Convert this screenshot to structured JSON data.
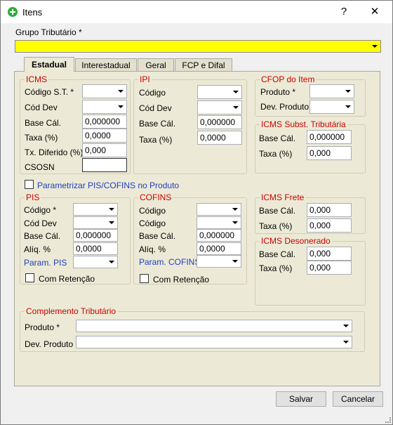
{
  "window": {
    "title": "Itens",
    "help": "?",
    "close": "✕"
  },
  "grupo": {
    "label": "Grupo Tributário *",
    "value": ""
  },
  "tabs": [
    "Estadual",
    "Interestadual",
    "Geral",
    "FCP e Difal"
  ],
  "icms": {
    "title": "ICMS",
    "codigo_st": "Código S.T. *",
    "cod_dev": "Cód Dev",
    "base_cal": "Base Cál.",
    "base_cal_value": "0,000000",
    "taxa": "Taxa (%)",
    "taxa_value": "0,0000",
    "tx_diferido": "Tx. Diferido (%)",
    "tx_diferido_value": "0,000",
    "csosn": "CSOSN",
    "csosn_value": ""
  },
  "ipi": {
    "title": "IPI",
    "codigo": "Código",
    "cod_dev": "Cód Dev",
    "base_cal": "Base Cál.",
    "base_cal_value": "0,000000",
    "taxa": "Taxa (%)",
    "taxa_value": "0,0000"
  },
  "cfop": {
    "title": "CFOP do Item",
    "produto": "Produto *",
    "dev_produto": "Dev. Produto"
  },
  "icms_st": {
    "title": "ICMS Subst. Tributária",
    "base_cal": "Base Cál.",
    "base_cal_value": "0,000000",
    "taxa": "Taxa (%)",
    "taxa_value": "0,000"
  },
  "param_pis_cofins": "Parametrizar PIS/COFINS no Produto",
  "pis": {
    "title": "PIS",
    "codigo": "Código *",
    "cod_dev": "Cód Dev",
    "base_cal": "Base Cál.",
    "base_cal_value": "0,000000",
    "aliq": "Alíq. %",
    "aliq_value": "0,0000",
    "param": "Param. PIS",
    "retencao": "Com Retenção"
  },
  "cofins": {
    "title": "COFINS",
    "codigo": "Código",
    "codigo2": "Código",
    "base_cal": "Base Cál.",
    "base_cal_value": "0,000000",
    "aliq": "Alíq. %",
    "aliq_value": "0,0000",
    "param": "Param. COFINS",
    "retencao": "Com Retenção"
  },
  "icms_frete": {
    "title": "ICMS Frete",
    "base_cal": "Base Cál.",
    "base_cal_value": "0,000",
    "taxa": "Taxa (%)",
    "taxa_value": "0,000"
  },
  "icms_desonerado": {
    "title": "ICMS Desonerado",
    "base_cal": "Base Cál.",
    "base_cal_value": "0,000",
    "taxa": "Taxa (%)",
    "taxa_value": "0,000"
  },
  "complemento": {
    "title": "Complemento Tributário",
    "produto": "Produto *",
    "dev_produto": "Dev. Produto *"
  },
  "buttons": {
    "salvar": "Salvar",
    "cancelar": "Cancelar"
  },
  "colors": {
    "grupo_bg": "#ffff00",
    "panel_bg": "#ecead6",
    "group_title": "#cc0000",
    "link_blue": "#1f3fbf"
  }
}
